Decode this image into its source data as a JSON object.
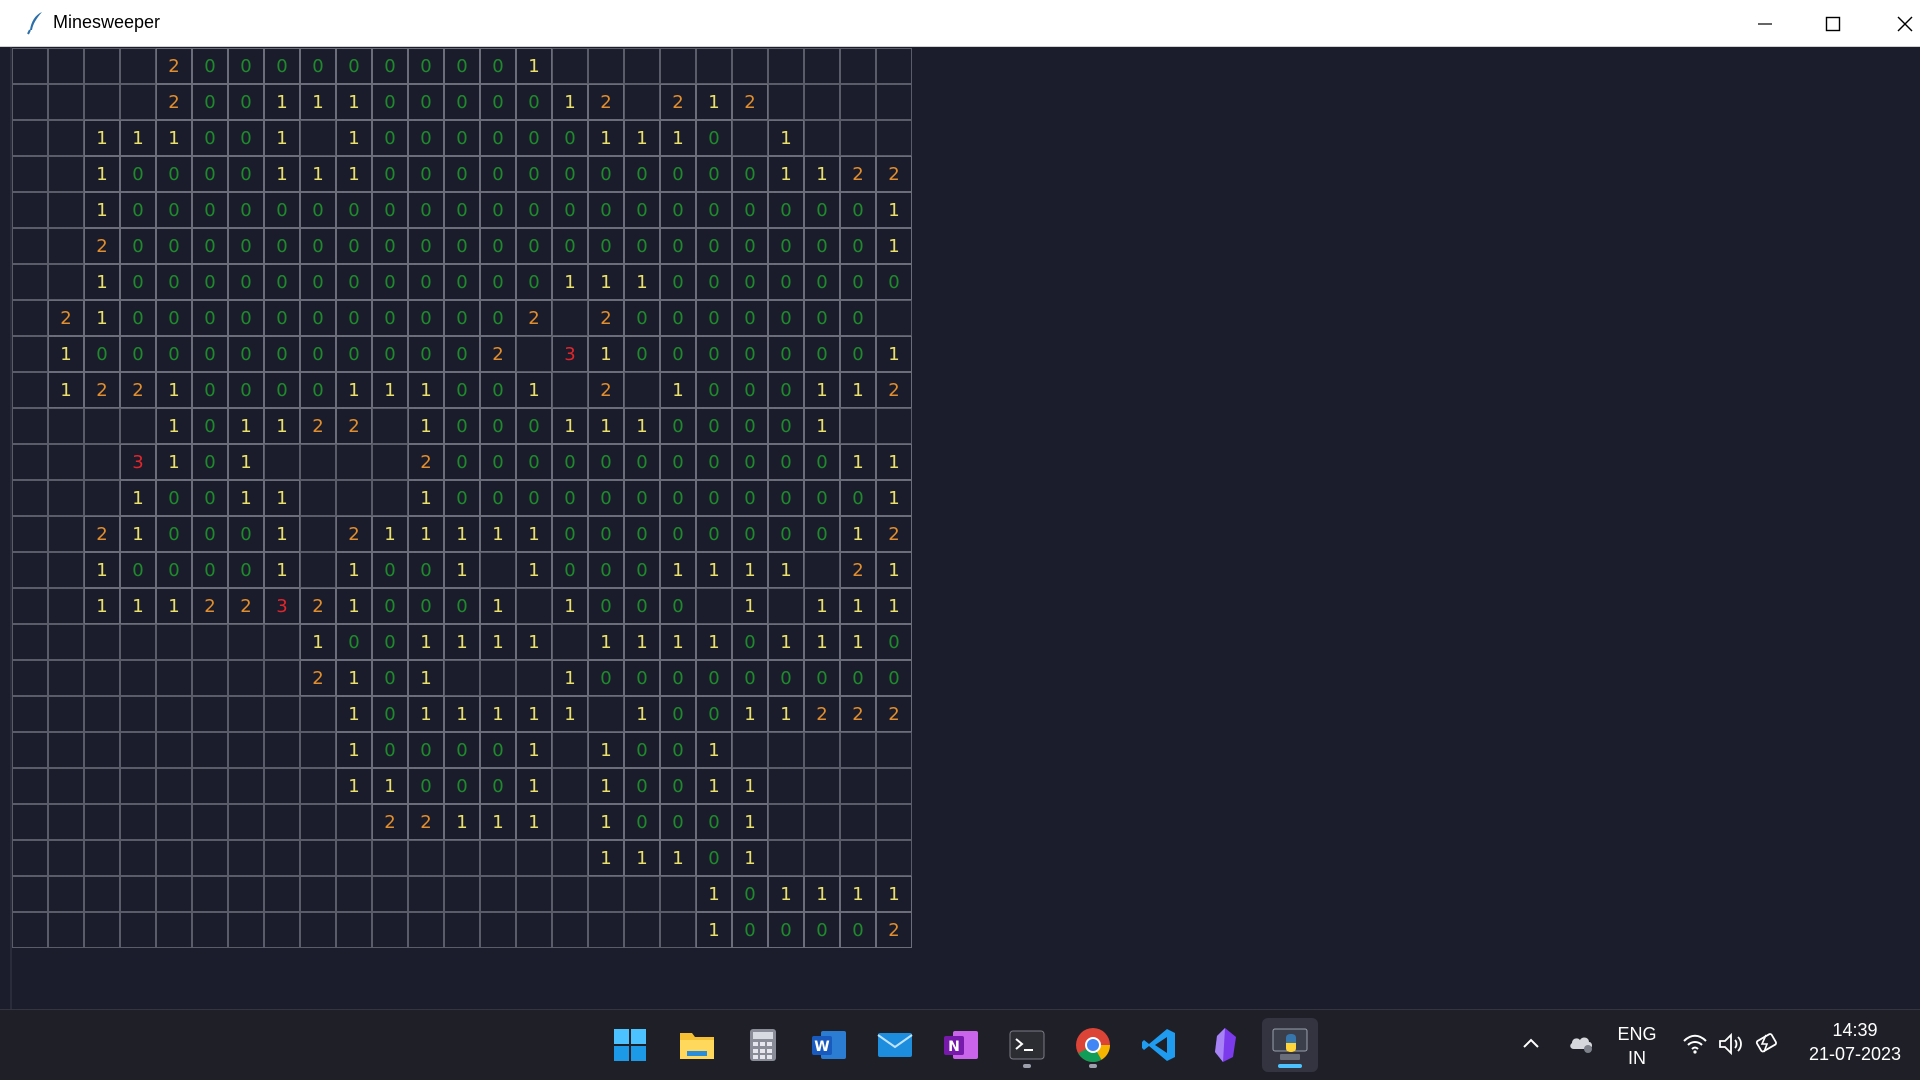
{
  "window": {
    "title": "Minesweeper",
    "accent": "#1b1d2d"
  },
  "colors": {
    "0": "#1f8a2c",
    "1": "#e9e06a",
    "2": "#e28e2c",
    "3": "#e1262b"
  },
  "board": {
    "rows": [
      "....20000000001.........",
      "....2001110000012.212....",
      "..111001.10000001110.1.....",
      "..10000111000000000001122.",
      "..10000000000000000000001.",
      "..200000000000000000000011",
      "..100000000000011100000000",
      ".21000000000002.20000000",
      ".1000000000002.31000000011",
      ".12210000111001.2.1000112.",
      "....101122.100011100001....",
      "...3101....20000000000011...",
      "...10011...10000000000001...",
      "..210001.2111110000000012..",
      "..100001.1001.10001111.21",
      "..111223210001.1000.1.11110",
      "........1001111.111101110000",
      "........2101...10000000000",
      ".........1011111.100112221",
      ".........100001.1001......",
      ".........110001.10011.....",
      "..........22111.10001.....",
      "................11101.....",
      "...................1011112.",
      "...................100002."
    ]
  },
  "taskbar": {
    "apps": [
      "start",
      "file-explorer",
      "calculator",
      "word",
      "mail",
      "onenote",
      "terminal",
      "chrome",
      "vscode",
      "obsidian",
      "python"
    ],
    "lang_top": "ENG",
    "lang_bottom": "IN",
    "time": "14:39",
    "date": "21-07-2023"
  }
}
